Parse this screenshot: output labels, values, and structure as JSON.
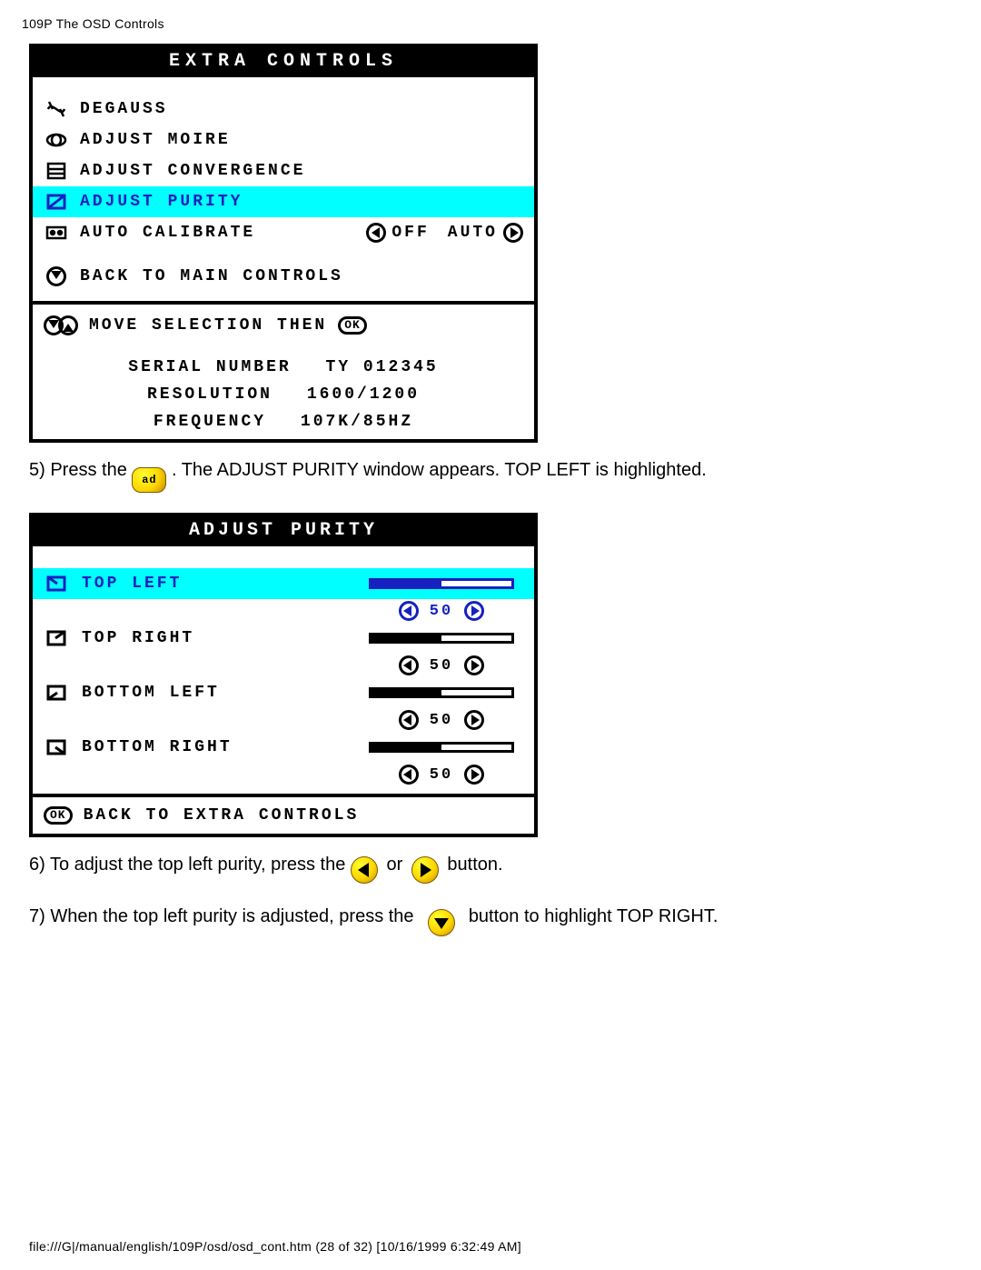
{
  "page": {
    "header": "109P The OSD Controls",
    "footer": "file:///G|/manual/english/109P/osd/osd_cont.htm (28 of 32) [10/16/1999 6:32:49 AM]"
  },
  "osd1": {
    "title": "Extra Controls",
    "items": {
      "degauss": "Degauss",
      "moire": "Adjust Moire",
      "convergence": "Adjust Convergence",
      "purity": "Adjust Purity",
      "autocal": "Auto Calibrate",
      "autocal_off": "Off",
      "autocal_auto": "Auto",
      "back": "Back to Main Controls"
    },
    "hint": "Move Selection then",
    "hint_ok": "OK",
    "info": {
      "serial_label": "Serial Number",
      "serial_value": "TY 012345",
      "resolution_label": "Resolution",
      "resolution_value": "1600/1200",
      "frequency_label": "Frequency",
      "frequency_value": "107K/85Hz"
    }
  },
  "step5": {
    "a": "5) Press the",
    "b": ". The ADJUST PURITY window appears. TOP LEFT is highlighted."
  },
  "osd2": {
    "title": "Adjust Purity",
    "items": {
      "top_left": "Top Left",
      "top_right": "Top Right",
      "bottom_left": "Bottom Left",
      "bottom_right": "Bottom Right"
    },
    "values": {
      "top_left": "50",
      "top_right": "50",
      "bottom_left": "50",
      "bottom_right": "50"
    },
    "back": "Back to Extra Controls",
    "back_ok": "OK"
  },
  "step6": {
    "a": "6) To adjust the top left purity, press the",
    "b": "or",
    "c": "button."
  },
  "step7": {
    "a": "7) When the top left purity is adjusted, press the",
    "b": "button to highlight TOP RIGHT."
  }
}
